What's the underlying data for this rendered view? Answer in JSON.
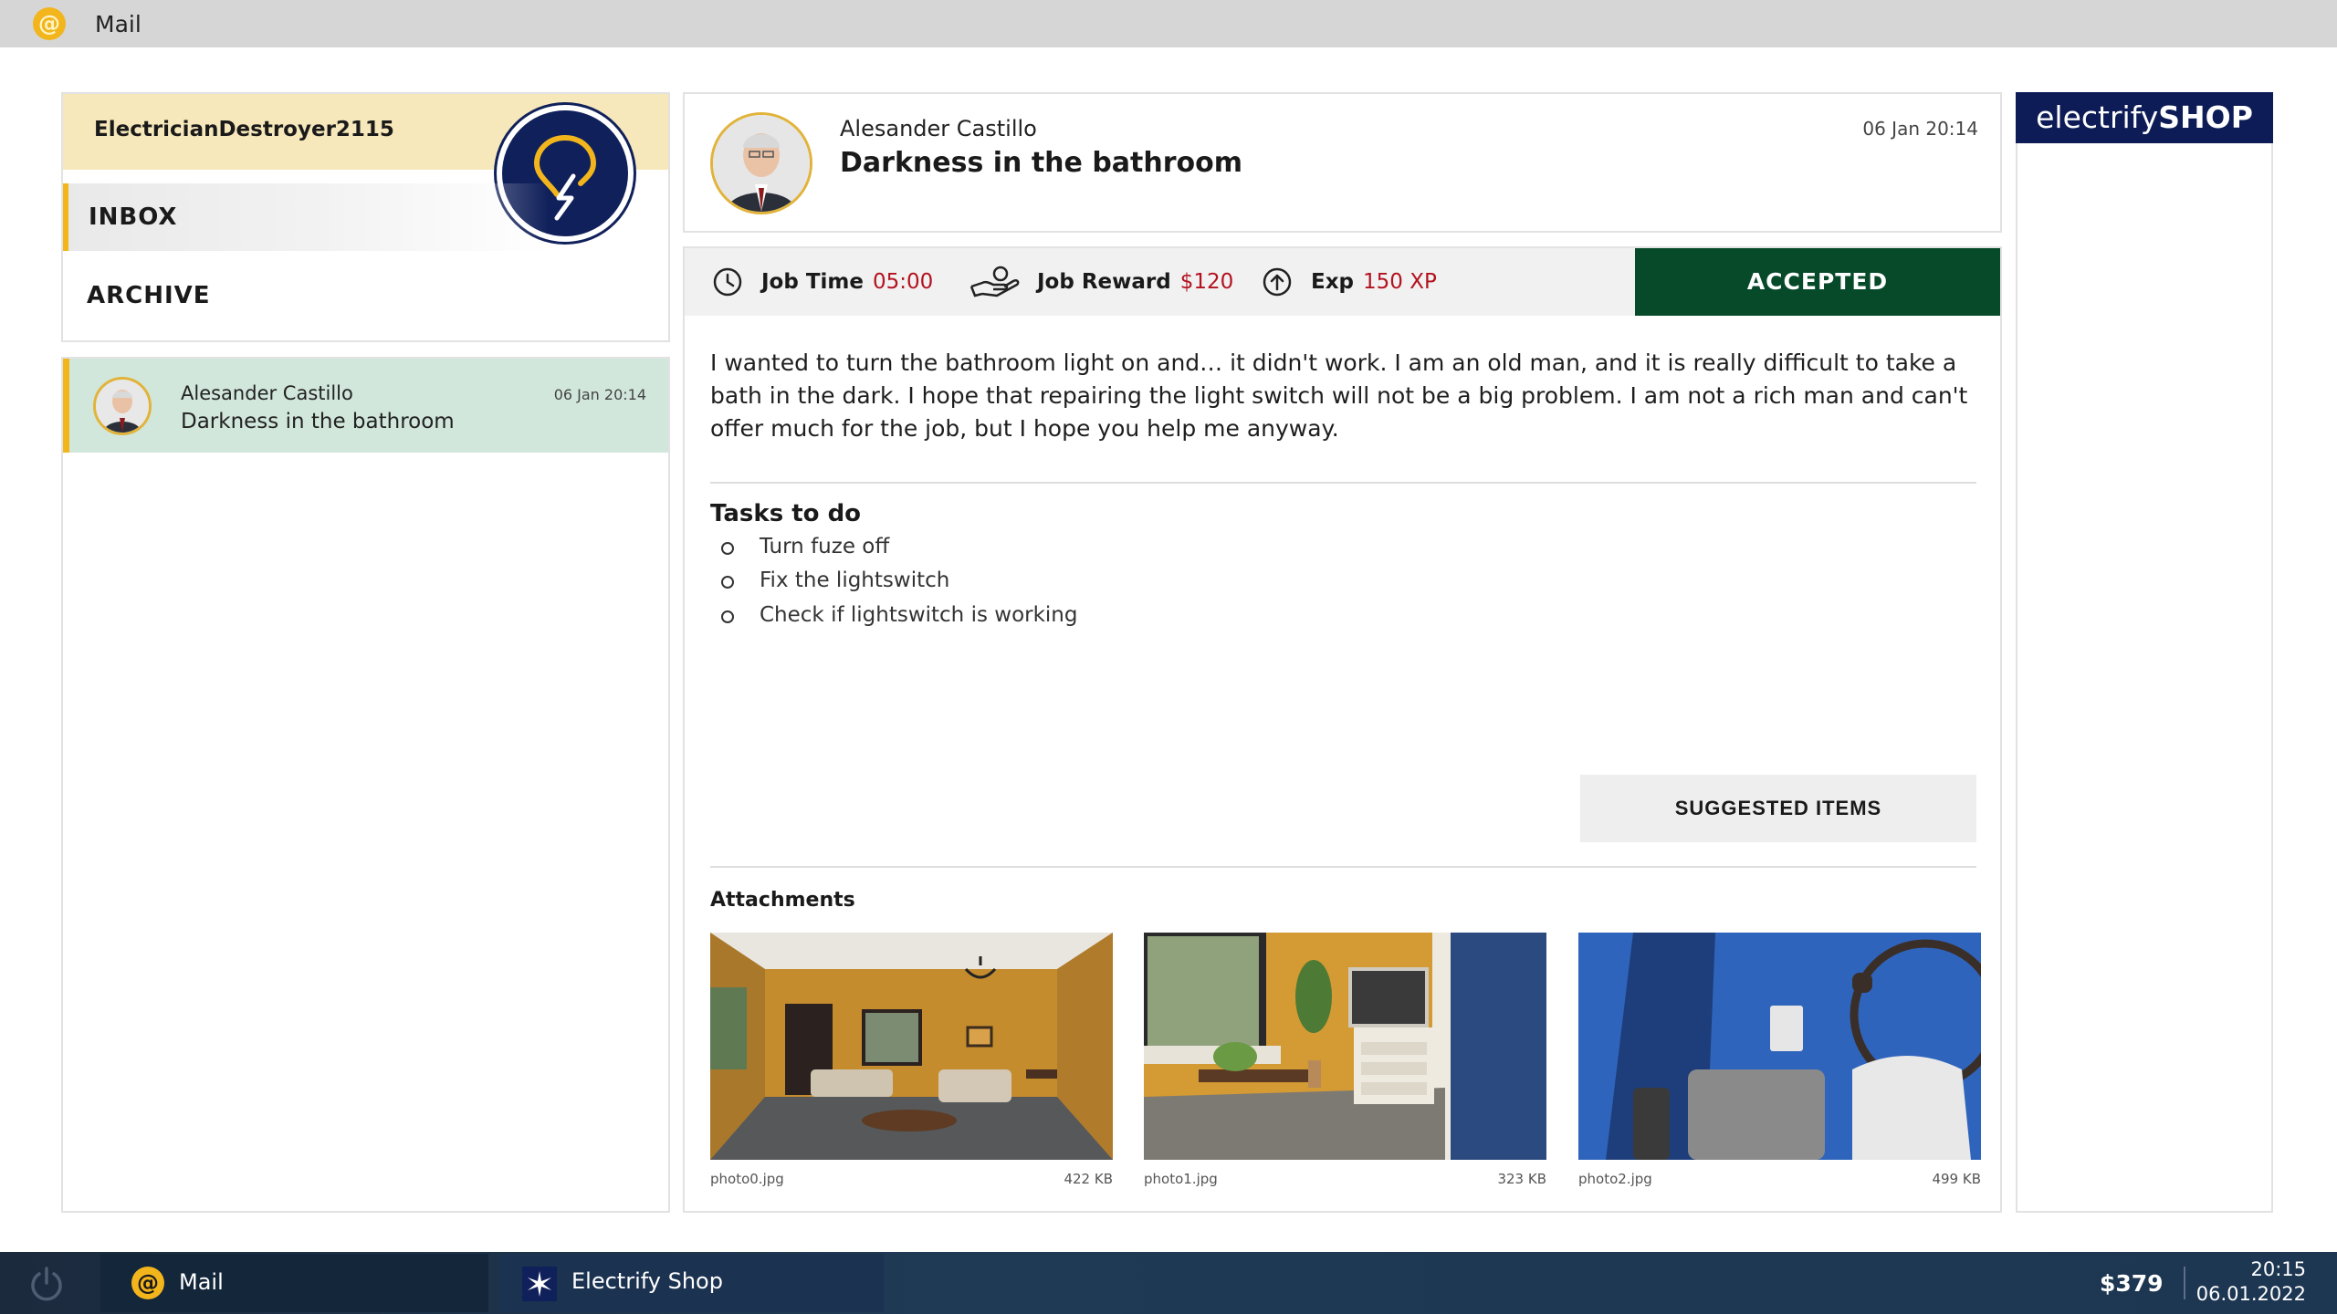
{
  "window": {
    "title": "Mail"
  },
  "sidebar": {
    "username": "ElectricianDestroyer2115",
    "nav": {
      "inbox": "INBOX",
      "archive": "ARCHIVE"
    }
  },
  "mail_list": [
    {
      "sender": "Alesander Castillo",
      "subject": "Darkness in the bathroom",
      "date": "06 Jan 20:14"
    }
  ],
  "mail": {
    "sender": "Alesander Castillo",
    "subject": "Darkness in the bathroom",
    "date": "06 Jan 20:14",
    "job_time_label": "Job Time",
    "job_time_value": "05:00",
    "job_reward_label": "Job Reward",
    "job_reward_value": "$120",
    "exp_label": "Exp",
    "exp_value": "150 XP",
    "status": "ACCEPTED",
    "body": "I wanted to turn the bathroom light on and… it didn't work. I am an old man, and it is really difficult to take a bath in the dark. I hope that repairing the light switch will not be a big problem.  I am not a rich man and can't offer much for the job, but I hope you help me anyway.",
    "tasks_title": "Tasks to do",
    "tasks": [
      "Turn fuze off",
      "Fix the lightswitch",
      "Check if lightswitch is working"
    ],
    "suggested_button": "SUGGESTED ITEMS",
    "attachments_title": "Attachments",
    "attachments": [
      {
        "name": "photo0.jpg",
        "size": "422 KB"
      },
      {
        "name": "photo1.jpg",
        "size": "323 KB"
      },
      {
        "name": "photo2.jpg",
        "size": "499 KB"
      }
    ]
  },
  "shop": {
    "brand_light": "electrify",
    "brand_bold": "SHOP"
  },
  "taskbar": {
    "mail_label": "Mail",
    "shop_label": "Electrify Shop",
    "money": "$379",
    "time": "20:15",
    "date": "06.01.2022"
  },
  "colors": {
    "accent_yellow": "#f2b51c",
    "accepted_green": "#064a2a",
    "value_red": "#b3121f",
    "brand_navy": "#0d1c56"
  }
}
